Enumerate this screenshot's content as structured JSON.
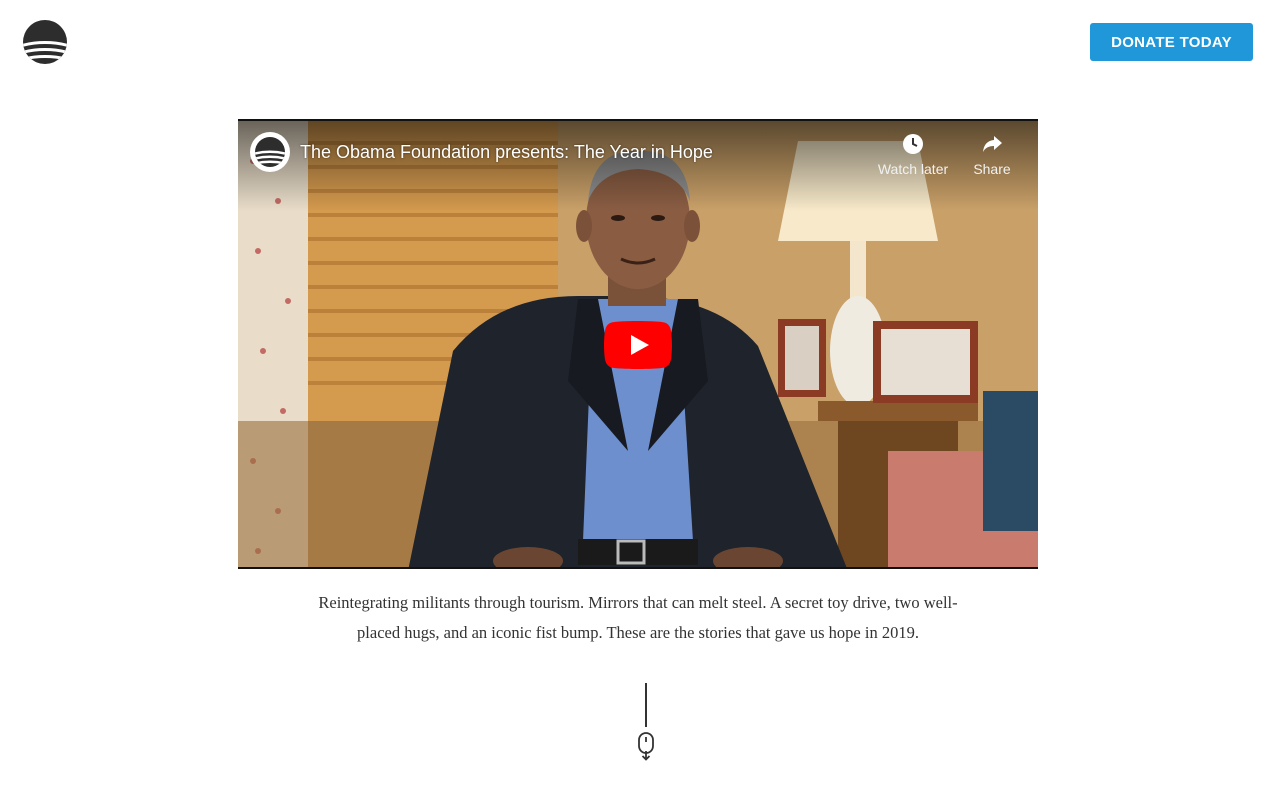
{
  "header": {
    "logo_icon": "obama-foundation-sunrise-logo",
    "donate_label": "DONATE TODAY",
    "donate_color": "#1f97d8"
  },
  "video": {
    "title": "The Obama Foundation presents: The Year in Hope",
    "channel_icon": "obama-foundation-sunrise-logo",
    "actions": {
      "watch_later_label": "Watch later",
      "share_label": "Share"
    },
    "play_button_color": "#ff0000"
  },
  "intro": {
    "text": "Reintegrating militants through tourism. Mirrors that can melt steel. A secret toy drive, two well-placed hugs, and an iconic fist bump. These are the stories that gave us hope in 2019."
  },
  "scroll_hint": {
    "icon": "scroll-mouse-icon"
  }
}
